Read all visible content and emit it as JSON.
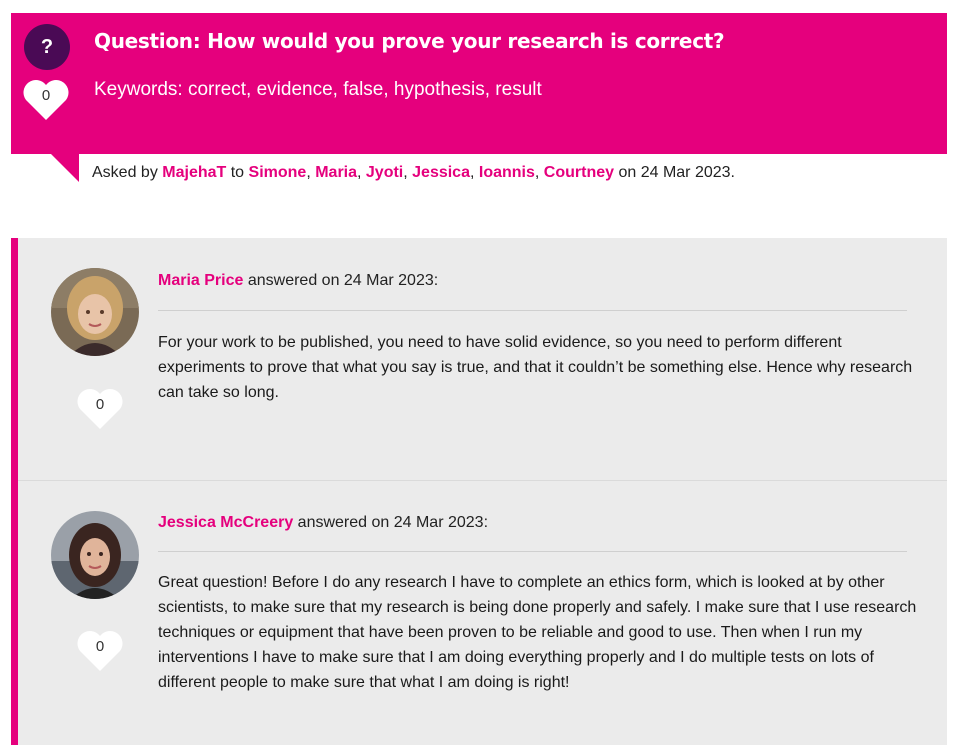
{
  "question": {
    "icon_symbol": "?",
    "title": "Question: How would you prove your research is correct?",
    "keywords": "Keywords: correct, evidence, false, hypothesis, result",
    "likes": "0",
    "asked_prefix": "Asked by",
    "asker": "MajehaT",
    "to_word": "to",
    "recipients": [
      "Simone",
      "Maria",
      "Jyoti",
      "Jessica",
      "Ioannis",
      "Courtney"
    ],
    "date_text": "on 24 Mar 2023."
  },
  "answers": [
    {
      "name": "Maria Price",
      "answered_text": "answered on 24 Mar 2023:",
      "likes": "0",
      "body": "For your work to be published, you need to have solid evidence, so you need to perform different experiments to prove that what you say is true, and that it couldn’t be something else. Hence why research can take so long."
    },
    {
      "name": "Jessica McCreery",
      "answered_text": "answered on 24 Mar 2023:",
      "likes": "0",
      "body": "Great question! Before I do any research I have to complete an ethics form, which is looked at by other scientists, to make sure that my research is being done properly and safely. I make sure that I use research techniques or equipment that have been proven to be reliable and good to use. Then when I run my interventions I have to make sure that I am doing everything properly and I do multiple tests on lots of different people to make sure that what I am doing is right!"
    }
  ],
  "colors": {
    "accent": "#e5007d",
    "icon_bg": "#4a0a55",
    "panel_bg": "#ebebeb"
  },
  "icons": {
    "question": "question-mark-icon",
    "like": "heart-icon"
  }
}
